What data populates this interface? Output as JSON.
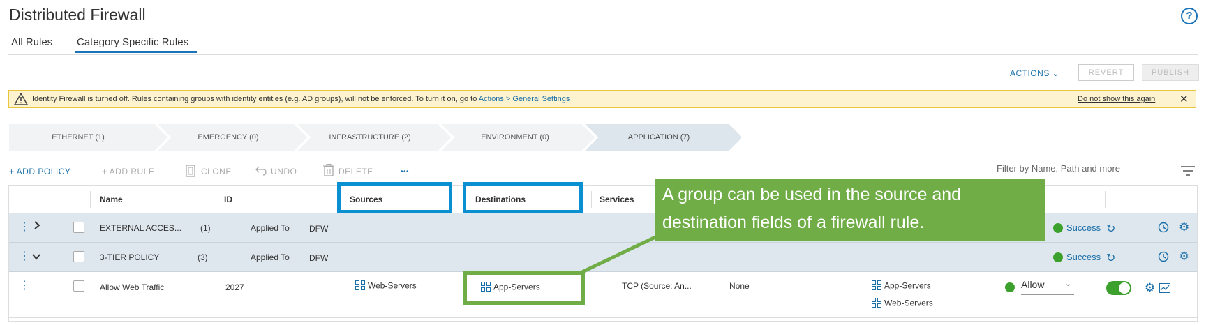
{
  "page": {
    "title": "Distributed Firewall",
    "help_icon": "?"
  },
  "tabs": [
    {
      "label": "All Rules"
    },
    {
      "label": "Category Specific Rules",
      "active": true
    }
  ],
  "header_actions": {
    "actions": "ACTIONS ⌄",
    "revert": "REVERT",
    "publish": "PUBLISH"
  },
  "banner": {
    "text": "Identity Firewall is turned off. Rules containing groups with identity entities (e.g. AD groups), will not be enforced. To turn it on, go to ",
    "link": "Actions > General Settings",
    "dismiss": "Do not show this again",
    "close": "✕"
  },
  "categories": [
    {
      "label": "ETHERNET (1)"
    },
    {
      "label": "EMERGENCY (0)"
    },
    {
      "label": "INFRASTRUCTURE (2)"
    },
    {
      "label": "ENVIRONMENT (0)"
    },
    {
      "label": "APPLICATION (7)",
      "active": true
    }
  ],
  "toolbar": {
    "add_policy": "+ ADD POLICY",
    "add_rule": "+ ADD RULE",
    "clone": "CLONE",
    "undo": "UNDO",
    "delete": "DELETE",
    "more": "•••",
    "filter_placeholder": "Filter by Name, Path and more"
  },
  "columns": {
    "name": "Name",
    "id": "ID",
    "sources": "Sources",
    "destinations": "Destinations",
    "services": "Services"
  },
  "policies": [
    {
      "name": "EXTERNAL ACCES...",
      "count": "(1)",
      "applied_to_label": "Applied To",
      "applied_to": "DFW",
      "status": "Success"
    },
    {
      "name": "3-TIER POLICY",
      "count": "(3)",
      "applied_to_label": "Applied To",
      "applied_to": "DFW",
      "status": "Success"
    }
  ],
  "rule": {
    "name": "Allow Web Traffic",
    "id": "2027",
    "source": "Web-Servers",
    "destination": "App-Servers",
    "service": "TCP (Source: An...",
    "profile": "None",
    "applied_to": [
      "App-Servers",
      "Web-Servers"
    ],
    "action": "Allow",
    "enabled": true
  },
  "callout": {
    "text": "A group can be used in the source and destination fields of a firewall rule."
  },
  "colors": {
    "accent": "#1a73b8",
    "success": "#3ca12c",
    "highlight_blue": "#0a8fd1",
    "callout_green": "#70ad47",
    "banner_bg": "#fdf3cf"
  }
}
